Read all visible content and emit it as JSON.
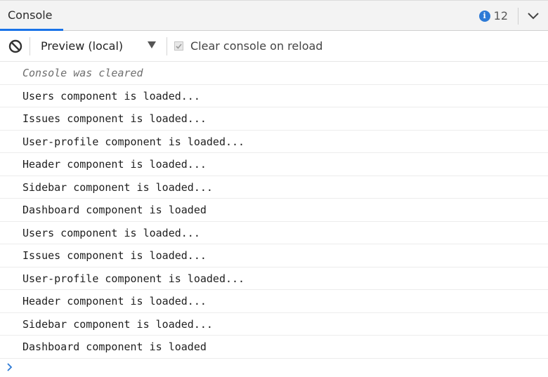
{
  "tab": {
    "label": "Console"
  },
  "info_count": "12",
  "toolbar": {
    "context_label": "Preview (local)",
    "clear_on_reload_label": "Clear console on reload",
    "clear_on_reload_checked": true
  },
  "messages": [
    {
      "text": "Console was cleared",
      "kind": "info"
    },
    {
      "text": "Users component is loaded...",
      "kind": "log"
    },
    {
      "text": "Issues component is loaded...",
      "kind": "log"
    },
    {
      "text": "User-profile component is loaded...",
      "kind": "log"
    },
    {
      "text": "Header component is loaded...",
      "kind": "log"
    },
    {
      "text": "Sidebar component is loaded...",
      "kind": "log"
    },
    {
      "text": "Dashboard component is loaded",
      "kind": "log"
    },
    {
      "text": "Users component is loaded...",
      "kind": "log"
    },
    {
      "text": "Issues component is loaded...",
      "kind": "log"
    },
    {
      "text": "User-profile component is loaded...",
      "kind": "log"
    },
    {
      "text": "Header component is loaded...",
      "kind": "log"
    },
    {
      "text": "Sidebar component is loaded...",
      "kind": "log"
    },
    {
      "text": "Dashboard component is loaded",
      "kind": "log"
    }
  ],
  "icons": {
    "info": "info-icon",
    "collapse": "chevron-down-icon",
    "clear": "block-icon",
    "dropdown": "triangle-down-icon",
    "checkbox": "check-icon",
    "prompt": "chevron-right-icon"
  },
  "colors": {
    "accent": "#1a73e8",
    "info_badge": "#2d7ad6",
    "prompt": "#2d7ad6"
  }
}
